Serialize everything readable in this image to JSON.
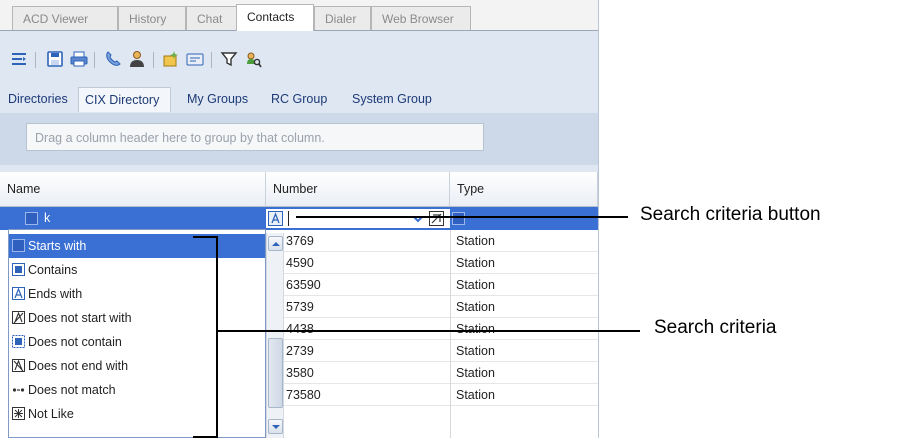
{
  "tabs": [
    {
      "label": "ACD Viewer",
      "active": false
    },
    {
      "label": "History",
      "active": false
    },
    {
      "label": "Chat",
      "active": false
    },
    {
      "label": "Contacts",
      "active": true
    },
    {
      "label": "Dialer",
      "active": false
    },
    {
      "label": "Web Browser",
      "active": false
    }
  ],
  "toolbar": {
    "icons": [
      "collapse-icon",
      "save-icon",
      "print-icon",
      "phone-icon",
      "person-icon",
      "new-contact-icon",
      "card-icon",
      "filter-icon",
      "search-person-icon"
    ]
  },
  "directory_tabs": [
    {
      "label": "Directories",
      "active": false
    },
    {
      "label": "CIX Directory",
      "active": true
    },
    {
      "label": "My Groups",
      "active": false
    },
    {
      "label": "RC Group",
      "active": false
    },
    {
      "label": "System Group",
      "active": false
    }
  ],
  "group_panel": {
    "placeholder": "Drag a column header here to group by that column."
  },
  "grid": {
    "columns": [
      "Name",
      "Number",
      "Type"
    ],
    "filter_row": {
      "name_value": "k",
      "number_value": ""
    },
    "rows": [
      {
        "number": "3769",
        "type": "Station"
      },
      {
        "number": "4590",
        "type": "Station"
      },
      {
        "number": "63590",
        "type": "Station"
      },
      {
        "number": "5739",
        "type": "Station"
      },
      {
        "number": "4438",
        "type": "Station"
      },
      {
        "number": "2739",
        "type": "Station"
      },
      {
        "number": "3580",
        "type": "Station"
      },
      {
        "number": "73580",
        "type": "Station"
      }
    ]
  },
  "search_criteria_menu": {
    "selected": "Starts with",
    "items": [
      "Starts with",
      "Contains",
      "Ends with",
      "Does not start with",
      "Does not contain",
      "Does not end with",
      "Does not match",
      "Not Like"
    ]
  },
  "annotations": {
    "button_label": "Search criteria button",
    "menu_label": "Search criteria"
  },
  "colors": {
    "selection_blue": "#3a6fd4",
    "panel_blue": "#dfe7f2"
  }
}
